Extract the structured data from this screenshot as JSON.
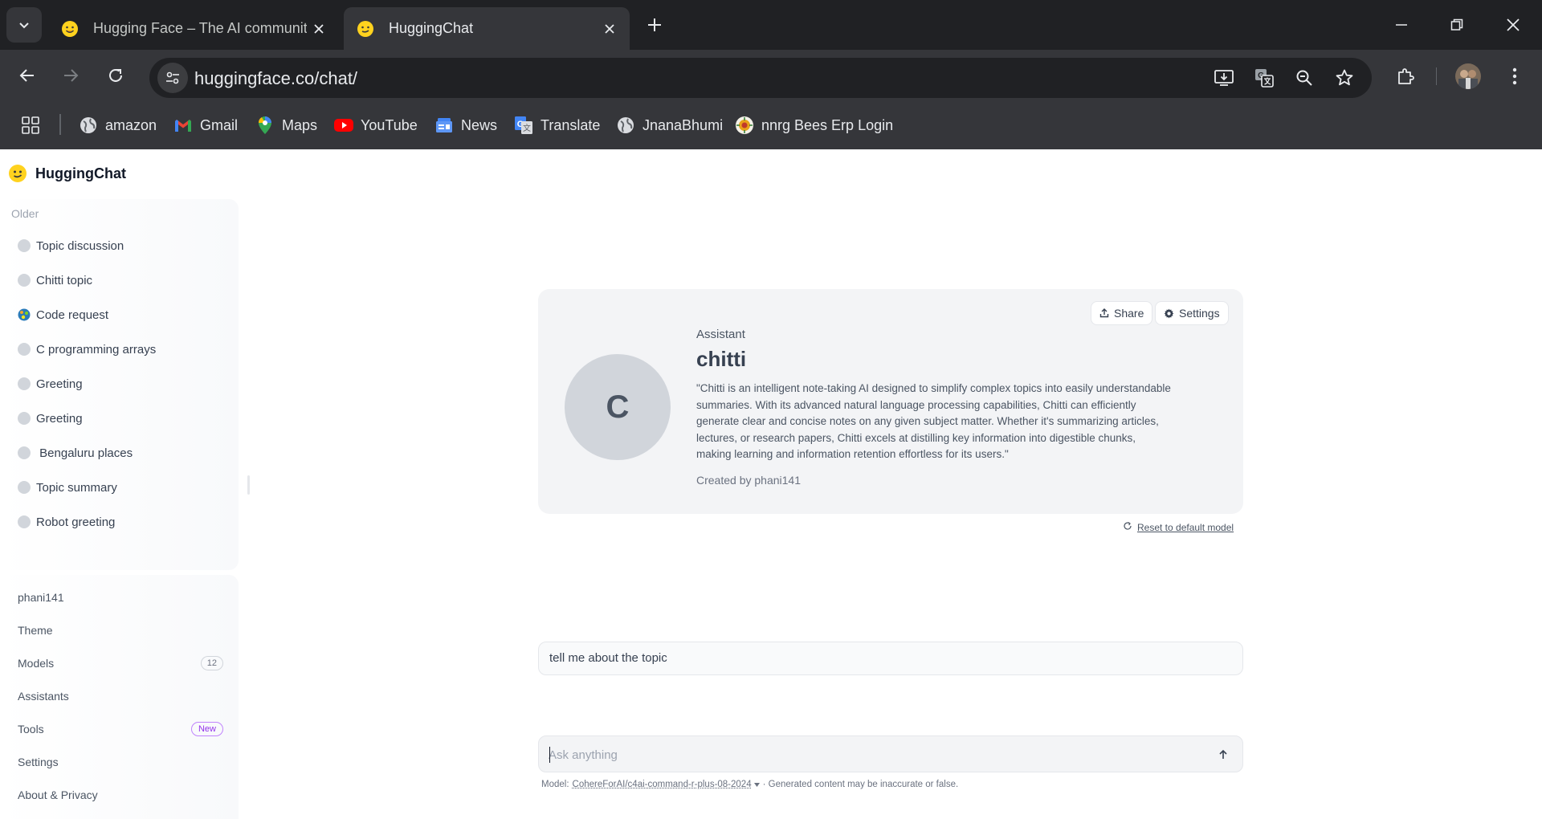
{
  "browser": {
    "tabs": [
      {
        "title": "Hugging Face – The AI community",
        "favicon": "hf-smile-icon",
        "active": false
      },
      {
        "title": "HuggingChat",
        "favicon": "huggingchat-icon",
        "active": true
      }
    ],
    "url": "huggingface.co/chat/",
    "bookmarks": [
      {
        "label": "amazon",
        "icon": "globe-icon"
      },
      {
        "label": "Gmail",
        "icon": "gmail-icon"
      },
      {
        "label": "Maps",
        "icon": "maps-icon"
      },
      {
        "label": "YouTube",
        "icon": "youtube-icon"
      },
      {
        "label": "News",
        "icon": "news-icon"
      },
      {
        "label": "Translate",
        "icon": "translate-icon"
      },
      {
        "label": "JnanaBhumi",
        "icon": "globe-icon"
      },
      {
        "label": "nnrg Bees Erp Login",
        "icon": "nnrg-icon"
      }
    ]
  },
  "app": {
    "name": "HuggingChat"
  },
  "sidebar": {
    "section_label": "Older",
    "conversations": [
      {
        "title": "Topic discussion",
        "icon": "dot"
      },
      {
        "title": "Chitti topic",
        "icon": "dot"
      },
      {
        "title": "Code request",
        "icon": "code-avatar-icon"
      },
      {
        "title": "C programming arrays",
        "icon": "dot"
      },
      {
        "title": "Greeting",
        "icon": "dot"
      },
      {
        "title": "Greeting",
        "icon": "dot"
      },
      {
        "title": " Bengaluru places",
        "icon": "dot"
      },
      {
        "title": "Topic summary",
        "icon": "dot"
      },
      {
        "title": "Robot greeting",
        "icon": "dot"
      }
    ],
    "menu": {
      "user": "phani141",
      "theme": "Theme",
      "models": "Models",
      "models_count": "12",
      "assistants": "Assistants",
      "tools": "Tools",
      "tools_badge": "New",
      "settings": "Settings",
      "about": "About & Privacy"
    }
  },
  "assistant": {
    "kicker": "Assistant",
    "name": "chitti",
    "avatar_letter": "C",
    "description": "\"Chitti is an intelligent note-taking AI designed to simplify complex topics into easily understandable summaries. With its advanced natural language processing capabilities, Chitti can efficiently generate clear and concise notes on any given subject matter. Whether it's summarizing articles, lectures, or research papers, Chitti excels at distilling key information into digestible chunks, making learning and information retention effortless for its users.\"",
    "created_by": "Created by phani141",
    "share_label": "Share",
    "settings_label": "Settings",
    "reset_label": "Reset to default model"
  },
  "chat": {
    "user_message": "tell me about the topic",
    "input_placeholder": "Ask anything",
    "footer_prefix": "Model:",
    "model_name": "CohereForAI/c4ai-command-r-plus-08-2024",
    "footer_suffix": "· Generated content may be inaccurate or false."
  },
  "colors": {
    "chrome_dark": "#202124",
    "chrome_toolbar": "#35363a",
    "card_bg": "#f3f4f6",
    "new_badge": "#9333ea"
  }
}
